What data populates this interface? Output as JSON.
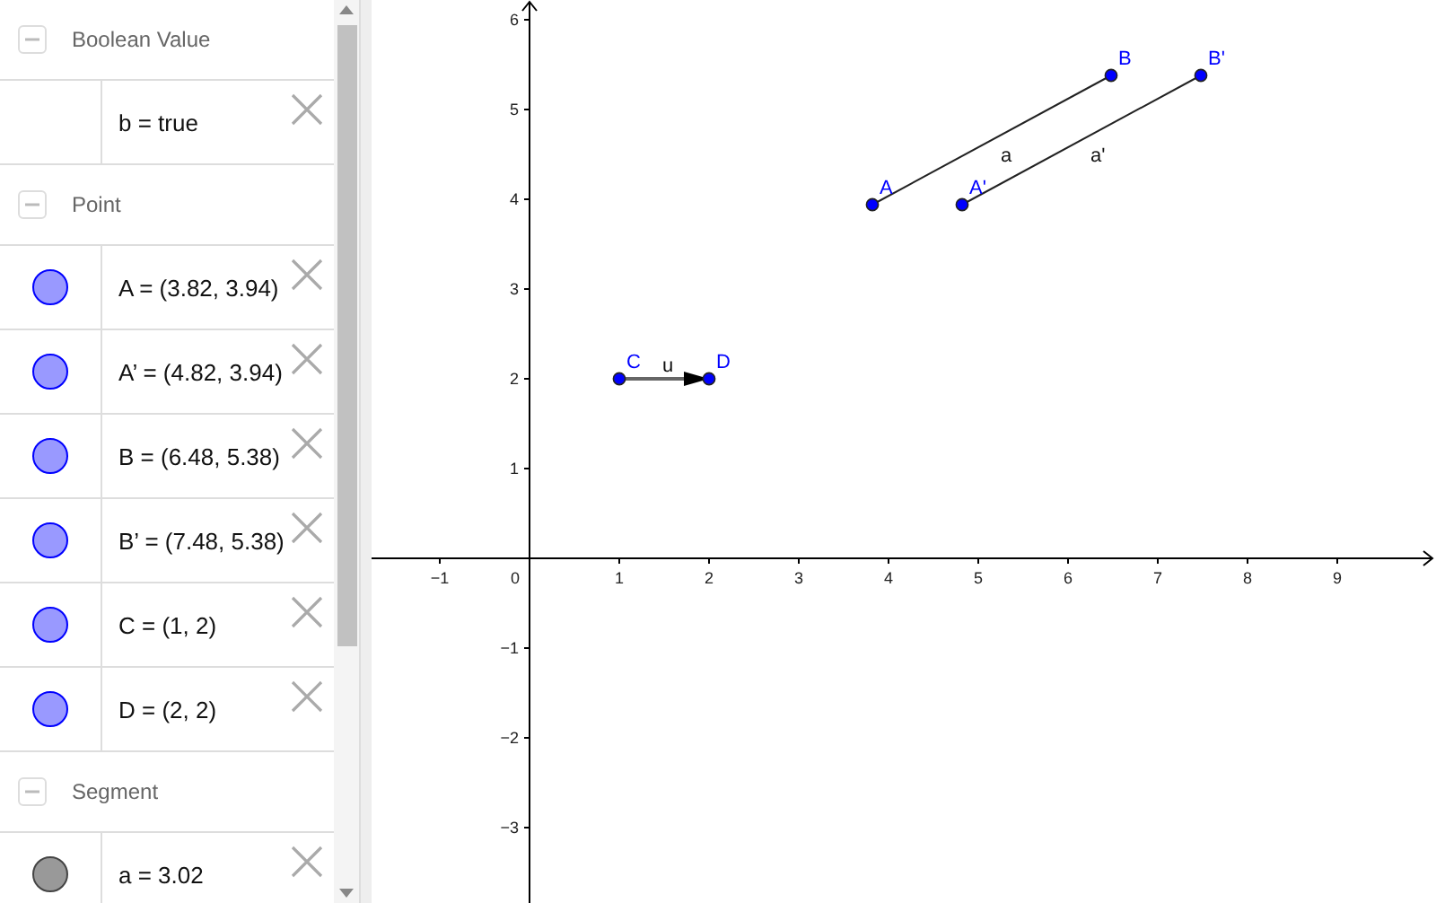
{
  "algebra": {
    "groups": [
      {
        "title": "Boolean Value",
        "expanded": true,
        "items": [
          {
            "kind": "boolean",
            "text": "b = true"
          }
        ]
      },
      {
        "title": "Point",
        "expanded": true,
        "items": [
          {
            "kind": "point",
            "text": "A = (3.82, 3.94)"
          },
          {
            "kind": "point",
            "text": "A’ = (4.82, 3.94)"
          },
          {
            "kind": "point",
            "text": "B = (6.48, 5.38)"
          },
          {
            "kind": "point",
            "text": "B’ = (7.48, 5.38)"
          },
          {
            "kind": "point",
            "text": "C = (1, 2)"
          },
          {
            "kind": "point",
            "text": "D = (2, 2)"
          }
        ]
      },
      {
        "title": "Segment",
        "expanded": true,
        "items": [
          {
            "kind": "segment",
            "text": "a = 3.02"
          }
        ]
      }
    ]
  },
  "graphics": {
    "x_axis": {
      "labels": [
        "−1",
        "1",
        "2",
        "3",
        "4",
        "5",
        "6",
        "7",
        "8",
        "9"
      ]
    },
    "y_axis": {
      "labels": [
        "6",
        "5",
        "4",
        "3",
        "2",
        "1",
        "−1",
        "−2",
        "−3"
      ]
    },
    "origin_label": "0",
    "lines": [
      {
        "kind": "segment",
        "label": "a"
      },
      {
        "kind": "segment",
        "label": "a'"
      },
      {
        "kind": "vector",
        "label": "u"
      }
    ],
    "points": [
      {
        "label": "A"
      },
      {
        "label": "A'"
      },
      {
        "label": "B"
      },
      {
        "label": "B'"
      },
      {
        "label": "C"
      },
      {
        "label": "D"
      }
    ]
  }
}
